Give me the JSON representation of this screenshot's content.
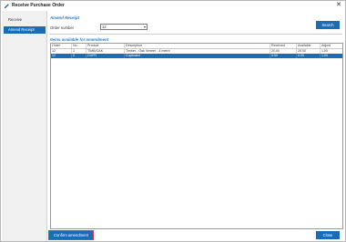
{
  "window": {
    "title": "Receive Purchase Order",
    "close_glyph": "✕"
  },
  "sidebar": {
    "items": [
      {
        "label": "Receive",
        "active": false
      },
      {
        "label": "Amend Receipt",
        "active": true
      }
    ]
  },
  "amend_receipt": {
    "heading": "Amend Receipt",
    "order_number_label": "Order number",
    "order_number_value": "12",
    "search_label": "Search"
  },
  "items_list": {
    "heading": "Items available for amendment",
    "columns": [
      "Order",
      "No.",
      "Product",
      "Description",
      "Received",
      "Available",
      "Adjust"
    ],
    "rows": [
      [
        "12",
        "1",
        "TIMB/OAK",
        "Timber - Oak Veneer - 4 metre",
        "20.00",
        "20.00",
        "1.00"
      ],
      [
        "12",
        "2",
        "CUFR",
        "Cupboard",
        "0.00",
        "0.00",
        "1.00"
      ]
    ],
    "selected_row": 1
  },
  "footer": {
    "confirm_label": "Confirm amendment",
    "close_label": "Close"
  },
  "colors": {
    "accent": "#1a6db5",
    "heading": "#2a7fd1",
    "focus_outline": "#e03b3b"
  },
  "icons": {
    "app_icon": "pencil-edit-icon",
    "close": "close-icon",
    "dropdown": "chevron-down-icon"
  }
}
